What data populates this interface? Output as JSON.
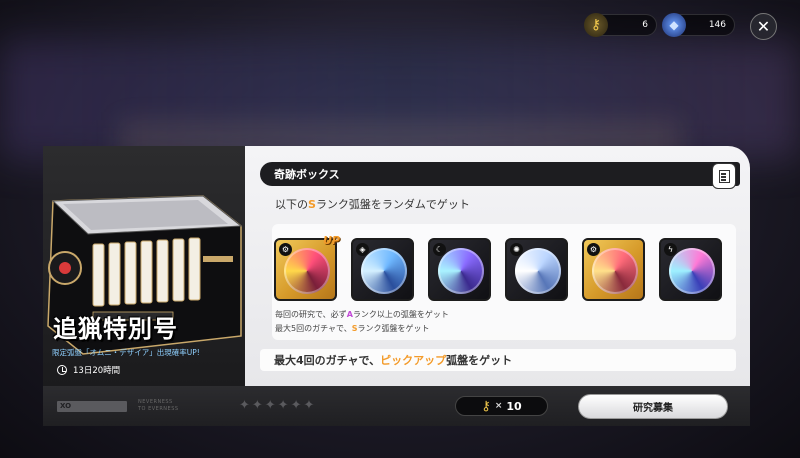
{
  "currency": {
    "keys_icon": "key-icon",
    "keys_amount": "6",
    "gems_icon": "gem-icon",
    "gems_amount": "146"
  },
  "close_icon": "close-icon",
  "promo": {
    "title": "追猟特別号",
    "subtitle": "限定弧盤「オムニ・デザイア」出現確率UP!",
    "timer": "13日20時間"
  },
  "panel": {
    "header": "奇跡ボックス",
    "subtitle_prefix": "以下の",
    "subtitle_rank": "S",
    "subtitle_suffix": "ランク弧盤をランダムでゲット",
    "up_tag": "UP",
    "items": [
      {
        "type_icon": "gear-icon",
        "colors": [
          "#ff4f7a",
          "#7a1f3a",
          "#ffd84a"
        ]
      },
      {
        "type_icon": "cube-icon",
        "colors": [
          "#6fb8ff",
          "#2a4e9c",
          "#d4f0ff"
        ]
      },
      {
        "type_icon": "moon-icon",
        "colors": [
          "#8a6bff",
          "#3b2a8e",
          "#a9f2ff"
        ]
      },
      {
        "type_icon": "swirl-icon",
        "colors": [
          "#bcd6ff",
          "#5776b8",
          "#ffffff"
        ]
      },
      {
        "type_icon": "gear-icon",
        "colors": [
          "#ff6b7a",
          "#8a2a3c",
          "#ffe08a"
        ]
      },
      {
        "type_icon": "bolt-icon",
        "colors": [
          "#ff7ad6",
          "#3a3fb8",
          "#9ef0ff"
        ]
      }
    ],
    "note1_prefix": "毎回の研究で、必ず",
    "note1_rank": "A",
    "note1_suffix": "ランク以上の弧盤をゲット",
    "note2_prefix": "最大5回のガチャで、",
    "note2_rank": "S",
    "note2_suffix": "ランク弧盤をゲット",
    "banner_prefix": "最大4回のガチャで、",
    "banner_highlight": "ピックアップ",
    "banner_suffix": "弧盤をゲット"
  },
  "bottom": {
    "logo_text": "XO",
    "brand_line1": "NEVERNESS",
    "brand_line2": "TO EVERNESS",
    "cost_times": "×",
    "cost_amount": "10",
    "recruit_label": "研究募集"
  },
  "colors": {
    "accent_orange": "#f39b2a",
    "accent_purple": "#c149d6",
    "subtitle_blue": "#8fd0ff"
  }
}
